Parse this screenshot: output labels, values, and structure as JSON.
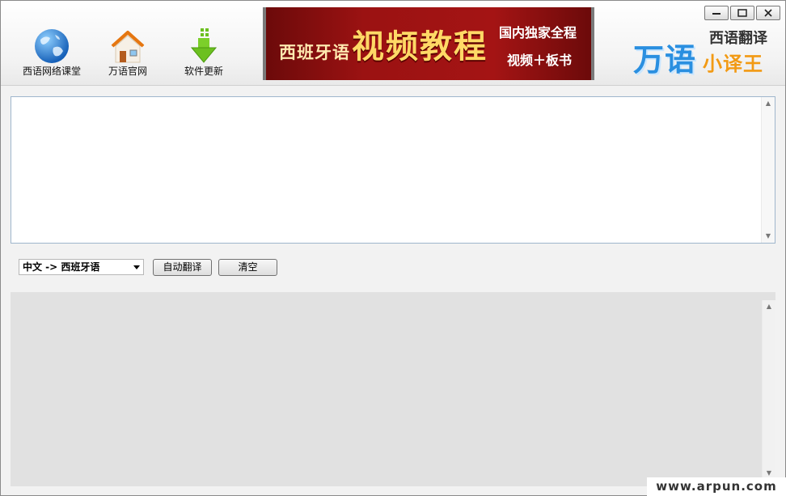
{
  "toolbar": {
    "items": [
      {
        "label": "西语网络课堂",
        "icon": "globe-icon"
      },
      {
        "label": "万语官网",
        "icon": "home-icon"
      },
      {
        "label": "软件更新",
        "icon": "download-arrow-icon"
      }
    ]
  },
  "banner": {
    "left_text": "西班牙语",
    "main_text": "视频教程",
    "right_top": "国内独家全程",
    "right_bottom": "视频＋板书"
  },
  "logo": {
    "top": "西语翻译",
    "main": "万语",
    "sub": "小译王"
  },
  "window_controls": [
    "minimize-icon",
    "maximize-icon",
    "close-icon"
  ],
  "input": {
    "value": "",
    "placeholder": ""
  },
  "controls": {
    "language_selected": "中文 -> 西班牙语",
    "auto_translate_label": "自动翻译",
    "clear_label": "清空"
  },
  "output": {
    "value": ""
  },
  "watermark": "www.arpun.com",
  "colors": {
    "banner_red": "#9b1212",
    "logo_blue": "#2a8fe0",
    "logo_orange": "#f29a14",
    "output_bg": "#e1e1e1"
  }
}
